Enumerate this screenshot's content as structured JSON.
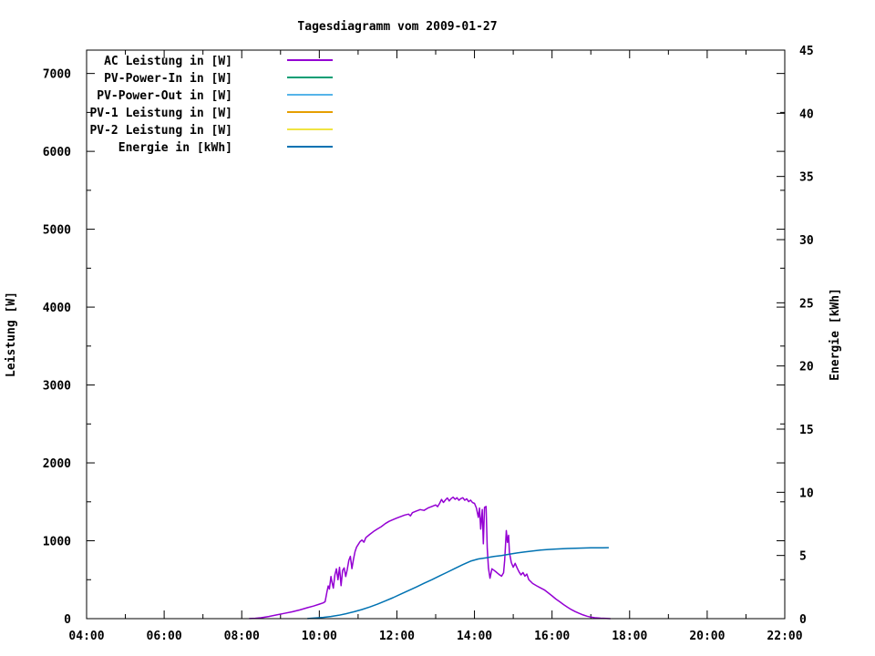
{
  "chart_data": {
    "type": "line",
    "title": "Tagesdiagramm vom 2009-01-27",
    "grid": false,
    "legend_position": "top-left-inside",
    "x": {
      "min_hour": 4,
      "max_hour": 22,
      "major_tick_labels": [
        "04:00",
        "06:00",
        "08:00",
        "10:00",
        "12:00",
        "14:00",
        "16:00",
        "18:00",
        "20:00",
        "22:00"
      ],
      "major_tick_hours": [
        4,
        6,
        8,
        10,
        12,
        14,
        16,
        18,
        20,
        22
      ],
      "minor_tick_hours": [
        5,
        7,
        9,
        11,
        13,
        15,
        17,
        19,
        21
      ]
    },
    "y_left": {
      "label": "Leistung [W]",
      "min": 0,
      "max": 7300,
      "major_ticks": [
        0,
        1000,
        2000,
        3000,
        4000,
        5000,
        6000,
        7000
      ],
      "major_tick_labels": [
        "0",
        "1000",
        "2000",
        "3000",
        "4000",
        "5000",
        "6000",
        "7000"
      ],
      "minor_ticks": [
        500,
        1500,
        2500,
        3500,
        4500,
        5500,
        6500
      ]
    },
    "y_right": {
      "label": "Energie [kWh]",
      "min": 0,
      "max": 45,
      "major_ticks": [
        0,
        5,
        10,
        15,
        20,
        25,
        30,
        35,
        40,
        45
      ],
      "major_tick_labels": [
        "0",
        "5",
        "10",
        "15",
        "20",
        "25",
        "30",
        "35",
        "40",
        "45"
      ]
    },
    "legend": [
      {
        "label": "AC Leistung in [W]",
        "color": "#9400D3"
      },
      {
        "label": "PV-Power-In in [W]",
        "color": "#009E73"
      },
      {
        "label": "PV-Power-Out in [W]",
        "color": "#56B4E9"
      },
      {
        "label": "PV-1 Leistung in [W]",
        "color": "#E69F00"
      },
      {
        "label": "PV-2 Leistung in [W]",
        "color": "#F0E442"
      },
      {
        "label": "Energie in [kWh]",
        "color": "#0072B2"
      }
    ],
    "series": [
      {
        "name": "AC Leistung in [W]",
        "color": "#9400D3",
        "axis": "left",
        "points": [
          [
            8.2,
            1
          ],
          [
            8.35,
            5
          ],
          [
            8.5,
            12
          ],
          [
            8.7,
            28
          ],
          [
            8.9,
            48
          ],
          [
            9.1,
            68
          ],
          [
            9.3,
            88
          ],
          [
            9.5,
            112
          ],
          [
            9.7,
            142
          ],
          [
            9.85,
            162
          ],
          [
            10.0,
            186
          ],
          [
            10.1,
            202
          ],
          [
            10.15,
            218
          ],
          [
            10.2,
            350
          ],
          [
            10.23,
            420
          ],
          [
            10.26,
            380
          ],
          [
            10.3,
            540
          ],
          [
            10.33,
            460
          ],
          [
            10.36,
            392
          ],
          [
            10.4,
            560
          ],
          [
            10.44,
            640
          ],
          [
            10.48,
            500
          ],
          [
            10.52,
            660
          ],
          [
            10.56,
            424
          ],
          [
            10.6,
            620
          ],
          [
            10.64,
            652
          ],
          [
            10.68,
            540
          ],
          [
            10.72,
            632
          ],
          [
            10.76,
            748
          ],
          [
            10.8,
            800
          ],
          [
            10.84,
            642
          ],
          [
            10.88,
            760
          ],
          [
            10.92,
            860
          ],
          [
            10.96,
            918
          ],
          [
            11.0,
            950
          ],
          [
            11.05,
            988
          ],
          [
            11.1,
            1010
          ],
          [
            11.15,
            982
          ],
          [
            11.2,
            1040
          ],
          [
            11.3,
            1082
          ],
          [
            11.4,
            1120
          ],
          [
            11.5,
            1152
          ],
          [
            11.6,
            1182
          ],
          [
            11.7,
            1220
          ],
          [
            11.8,
            1250
          ],
          [
            11.9,
            1272
          ],
          [
            12.0,
            1292
          ],
          [
            12.1,
            1312
          ],
          [
            12.2,
            1330
          ],
          [
            12.3,
            1342
          ],
          [
            12.35,
            1320
          ],
          [
            12.4,
            1360
          ],
          [
            12.5,
            1382
          ],
          [
            12.6,
            1400
          ],
          [
            12.7,
            1390
          ],
          [
            12.8,
            1420
          ],
          [
            12.9,
            1440
          ],
          [
            13.0,
            1460
          ],
          [
            13.05,
            1438
          ],
          [
            13.1,
            1480
          ],
          [
            13.15,
            1530
          ],
          [
            13.2,
            1492
          ],
          [
            13.25,
            1522
          ],
          [
            13.3,
            1550
          ],
          [
            13.35,
            1512
          ],
          [
            13.4,
            1542
          ],
          [
            13.45,
            1560
          ],
          [
            13.5,
            1532
          ],
          [
            13.55,
            1552
          ],
          [
            13.6,
            1520
          ],
          [
            13.65,
            1542
          ],
          [
            13.7,
            1552
          ],
          [
            13.75,
            1520
          ],
          [
            13.8,
            1540
          ],
          [
            13.85,
            1502
          ],
          [
            13.9,
            1522
          ],
          [
            13.95,
            1490
          ],
          [
            14.0,
            1480
          ],
          [
            14.05,
            1420
          ],
          [
            14.1,
            1300
          ],
          [
            14.13,
            1420
          ],
          [
            14.16,
            1150
          ],
          [
            14.2,
            1400
          ],
          [
            14.23,
            960
          ],
          [
            14.26,
            1430
          ],
          [
            14.3,
            1440
          ],
          [
            14.33,
            900
          ],
          [
            14.36,
            650
          ],
          [
            14.4,
            520
          ],
          [
            14.45,
            640
          ],
          [
            14.5,
            622
          ],
          [
            14.55,
            602
          ],
          [
            14.6,
            582
          ],
          [
            14.65,
            562
          ],
          [
            14.7,
            545
          ],
          [
            14.75,
            590
          ],
          [
            14.78,
            750
          ],
          [
            14.82,
            1130
          ],
          [
            14.85,
            980
          ],
          [
            14.88,
            1070
          ],
          [
            14.9,
            850
          ],
          [
            14.95,
            720
          ],
          [
            15.0,
            660
          ],
          [
            15.05,
            710
          ],
          [
            15.1,
            650
          ],
          [
            15.15,
            600
          ],
          [
            15.2,
            562
          ],
          [
            15.25,
            592
          ],
          [
            15.3,
            545
          ],
          [
            15.35,
            572
          ],
          [
            15.4,
            502
          ],
          [
            15.5,
            452
          ],
          [
            15.6,
            422
          ],
          [
            15.7,
            396
          ],
          [
            15.8,
            370
          ],
          [
            15.9,
            332
          ],
          [
            16.0,
            292
          ],
          [
            16.1,
            252
          ],
          [
            16.2,
            216
          ],
          [
            16.3,
            180
          ],
          [
            16.4,
            146
          ],
          [
            16.5,
            116
          ],
          [
            16.6,
            90
          ],
          [
            16.7,
            68
          ],
          [
            16.8,
            48
          ],
          [
            16.9,
            32
          ],
          [
            17.0,
            20
          ],
          [
            17.1,
            12
          ],
          [
            17.25,
            6
          ],
          [
            17.4,
            2
          ],
          [
            17.5,
            0
          ]
        ]
      },
      {
        "name": "PV-Power-In in [W]",
        "color": "#009E73",
        "axis": "left",
        "points": []
      },
      {
        "name": "PV-Power-Out in [W]",
        "color": "#56B4E9",
        "axis": "left",
        "points": []
      },
      {
        "name": "PV-1 Leistung in [W]",
        "color": "#E69F00",
        "axis": "left",
        "points": []
      },
      {
        "name": "PV-2 Leistung in [W]",
        "color": "#F0E442",
        "axis": "left",
        "points": []
      },
      {
        "name": "Energie in [kWh]",
        "color": "#0072B2",
        "axis": "right",
        "points": [
          [
            9.7,
            0.01
          ],
          [
            9.9,
            0.05
          ],
          [
            10.1,
            0.1
          ],
          [
            10.3,
            0.17
          ],
          [
            10.5,
            0.27
          ],
          [
            10.7,
            0.4
          ],
          [
            10.9,
            0.55
          ],
          [
            11.1,
            0.72
          ],
          [
            11.3,
            0.92
          ],
          [
            11.5,
            1.15
          ],
          [
            11.7,
            1.4
          ],
          [
            11.9,
            1.66
          ],
          [
            12.1,
            1.94
          ],
          [
            12.3,
            2.22
          ],
          [
            12.5,
            2.5
          ],
          [
            12.7,
            2.8
          ],
          [
            12.9,
            3.08
          ],
          [
            13.1,
            3.38
          ],
          [
            13.3,
            3.68
          ],
          [
            13.5,
            3.98
          ],
          [
            13.7,
            4.28
          ],
          [
            13.9,
            4.55
          ],
          [
            14.1,
            4.72
          ],
          [
            14.3,
            4.82
          ],
          [
            14.5,
            4.92
          ],
          [
            14.7,
            5.0
          ],
          [
            14.9,
            5.1
          ],
          [
            15.1,
            5.2
          ],
          [
            15.3,
            5.28
          ],
          [
            15.5,
            5.36
          ],
          [
            15.7,
            5.42
          ],
          [
            15.9,
            5.47
          ],
          [
            16.1,
            5.51
          ],
          [
            16.4,
            5.55
          ],
          [
            16.7,
            5.58
          ],
          [
            17.0,
            5.6
          ],
          [
            17.3,
            5.61
          ],
          [
            17.45,
            5.62
          ]
        ]
      }
    ]
  }
}
